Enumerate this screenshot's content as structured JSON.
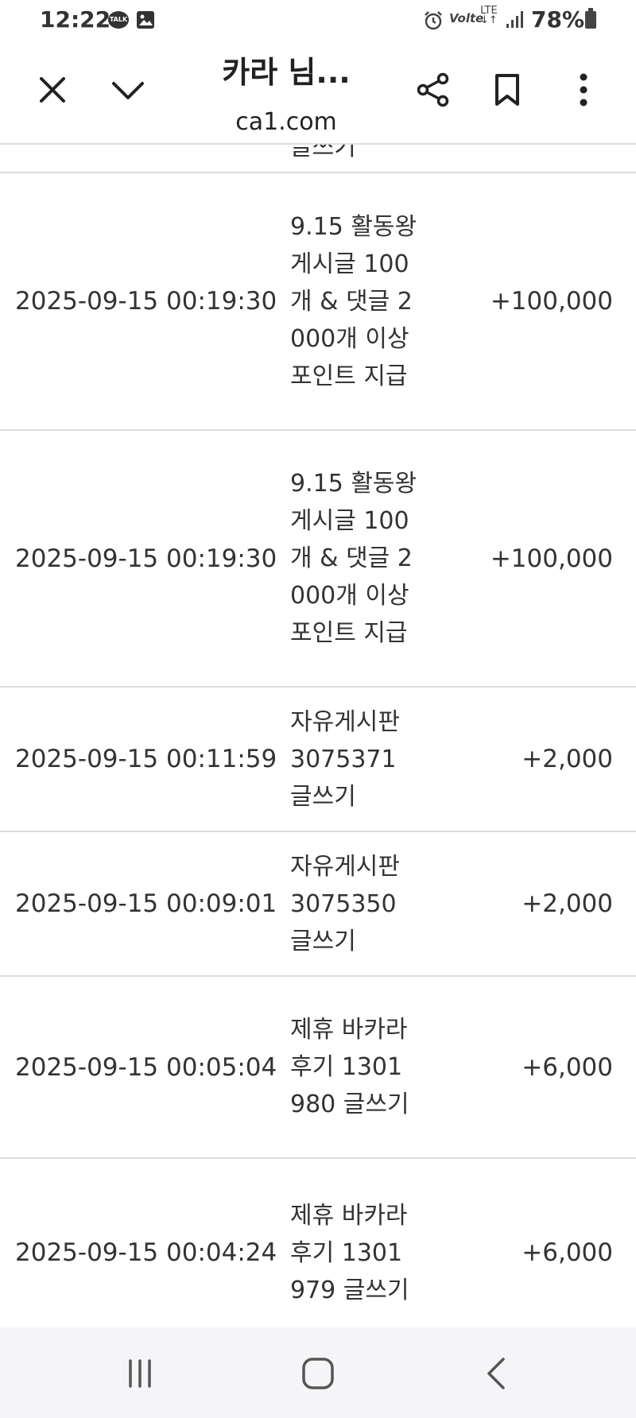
{
  "status_bar": {
    "time": "12:22",
    "talk_label": "TALK",
    "volte": "Volte",
    "lte": "LTE",
    "battery": "78%"
  },
  "toolbar": {
    "title": "카라 님...",
    "url": "ca1.com"
  },
  "table": {
    "partial_top_text": "글쓰기",
    "rows": [
      {
        "date": "2025-09-15 00:19:30",
        "description": "9.15 활동왕 게시글 100개 & 댓글 2000개 이상 포인트 지급",
        "points": "+100,000"
      },
      {
        "date": "2025-09-15 00:19:30",
        "description": "9.15 활동왕 게시글 100개 & 댓글 2000개 이상 포인트 지급",
        "points": "+100,000"
      },
      {
        "date": "2025-09-15 00:11:59",
        "description": "자유게시판 3075371 글쓰기",
        "points": "+2,000"
      },
      {
        "date": "2025-09-15 00:09:01",
        "description": "자유게시판 3075350 글쓰기",
        "points": "+2,000"
      },
      {
        "date": "2025-09-15 00:05:04",
        "description": "제휴 바카라후기 1301980 글쓰기",
        "points": "+6,000"
      },
      {
        "date": "2025-09-15 00:04:24",
        "description": "제휴 바카라후기 1301979 글쓰기",
        "points": "+6,000"
      }
    ]
  },
  "icons": {
    "close": "close-icon",
    "collapse": "chevron-down-icon",
    "share": "share-icon",
    "bookmark": "bookmark-icon",
    "more": "more-vertical-icon",
    "recents": "recent-apps-icon",
    "home": "home-icon",
    "back": "back-icon"
  }
}
